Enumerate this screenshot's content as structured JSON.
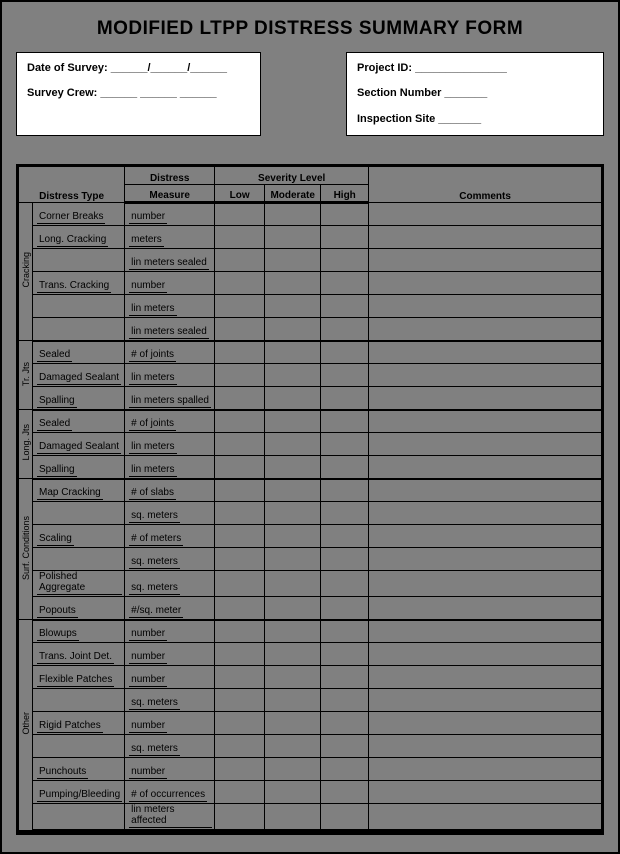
{
  "title": "MODIFIED LTPP DISTRESS SUMMARY FORM",
  "header_left": {
    "date_label": "Date of Survey: ______/______/______",
    "crew_label": "Survey Crew: ______   ______   ______"
  },
  "header_right": {
    "project_label": "Project ID:  _______________",
    "section_label": "Section Number _______",
    "site_label": "Inspection Site _______"
  },
  "columns": {
    "distress_type": "Distress Type",
    "distress_measure_top": "Distress",
    "distress_measure_bot": "Measure",
    "severity_level": "Severity Level",
    "low": "Low",
    "moderate": "Moderate",
    "high": "High",
    "comments": "Comments"
  },
  "groups": [
    {
      "name": "Cracking",
      "rows": [
        {
          "type": "Corner Breaks",
          "measure": "number"
        },
        {
          "type": "Long. Cracking",
          "measure": "meters"
        },
        {
          "type": "",
          "measure": "lin meters sealed"
        },
        {
          "type": "Trans. Cracking",
          "measure": "number"
        },
        {
          "type": "",
          "measure": "lin meters"
        },
        {
          "type": "",
          "measure": "lin meters sealed"
        }
      ]
    },
    {
      "name": "Tr. Jts",
      "rows": [
        {
          "type": "Sealed",
          "measure": "# of joints"
        },
        {
          "type": "Damaged Sealant",
          "measure": "lin meters"
        },
        {
          "type": "Spalling",
          "measure": "lin meters spalled"
        }
      ]
    },
    {
      "name": "Long. Jts",
      "rows": [
        {
          "type": "Sealed",
          "measure": "# of joints"
        },
        {
          "type": "Damaged Sealant",
          "measure": "lin meters"
        },
        {
          "type": "Spalling",
          "measure": "lin meters"
        }
      ]
    },
    {
      "name": "Surf. Conditions",
      "rows": [
        {
          "type": "Map Cracking",
          "measure": "# of slabs"
        },
        {
          "type": "",
          "measure": "sq. meters"
        },
        {
          "type": "Scaling",
          "measure": "# of meters"
        },
        {
          "type": "",
          "measure": "sq. meters"
        },
        {
          "type": "Polished Aggregate",
          "measure": "sq. meters"
        },
        {
          "type": "Popouts",
          "measure": "#/sq. meter"
        }
      ]
    },
    {
      "name": "Other",
      "rows": [
        {
          "type": "Blowups",
          "measure": "number"
        },
        {
          "type": "Trans. Joint Det.",
          "measure": "number"
        },
        {
          "type": "Flexible Patches",
          "measure": "number"
        },
        {
          "type": "",
          "measure": "sq. meters"
        },
        {
          "type": "Rigid Patches",
          "measure": "number"
        },
        {
          "type": "",
          "measure": "sq. meters"
        },
        {
          "type": "Punchouts",
          "measure": "number"
        },
        {
          "type": "Pumping/Bleeding",
          "measure": "# of occurrences"
        },
        {
          "type": "",
          "measure": "lin meters affected"
        }
      ]
    }
  ]
}
